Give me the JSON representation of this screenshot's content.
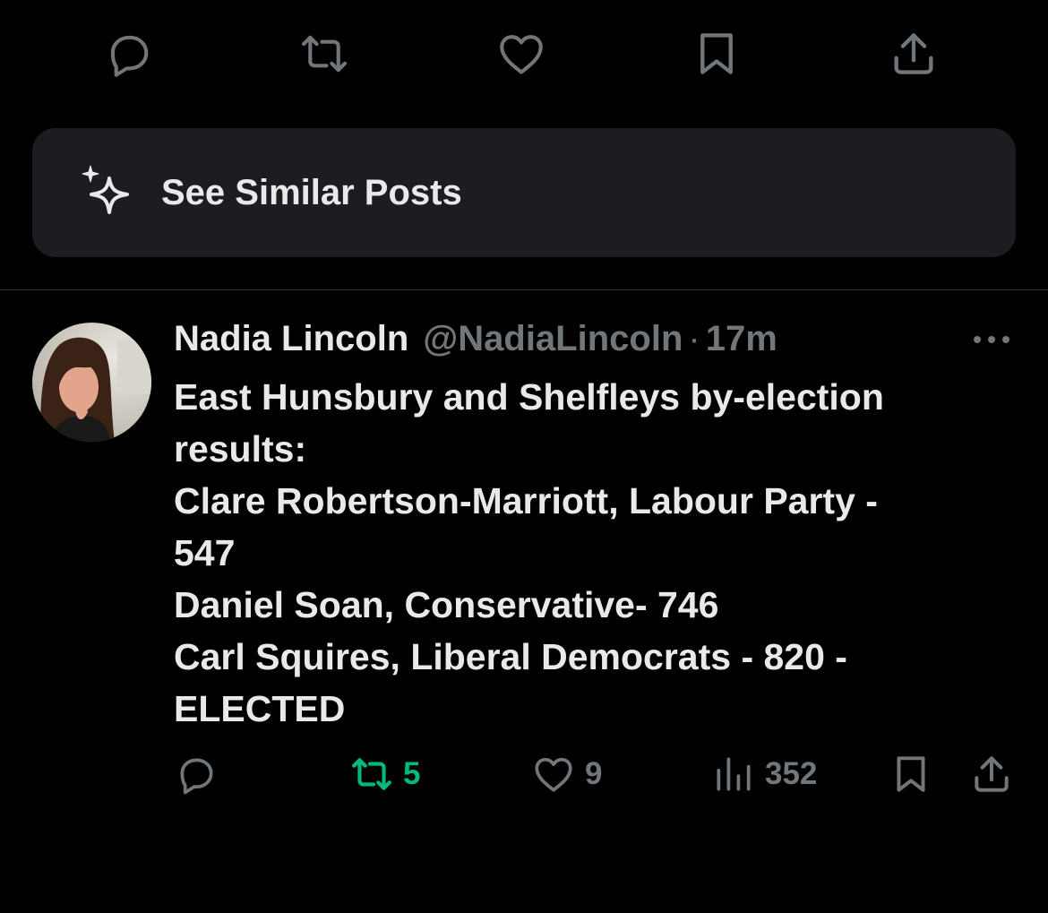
{
  "top_actions": {
    "reply_icon": "reply-icon",
    "repost_icon": "repost-icon",
    "like_icon": "heart-icon",
    "bookmark_icon": "bookmark-icon",
    "share_icon": "share-icon"
  },
  "similar": {
    "label": "See Similar Posts",
    "icon": "sparkle-icon"
  },
  "post": {
    "display_name": "Nadia Lincoln",
    "handle": "@NadiaLincoln",
    "separator": "·",
    "time": "17m",
    "text_lines": [
      "East Hunsbury and Shelfleys by-election",
      "results:",
      "Clare Robertson-Marriott, Labour Party -",
      "547",
      "Daniel Soan, Conservative- 746",
      "Carl Squires, Liberal Democrats - 820 -",
      "ELECTED"
    ],
    "actions": {
      "reposts": "5",
      "likes": "9",
      "views": "352"
    }
  },
  "colors": {
    "background": "#000000",
    "card": "#1c1d20",
    "text": "#e7e9ea",
    "muted": "#71767b",
    "repost_active": "#00ba7c"
  }
}
